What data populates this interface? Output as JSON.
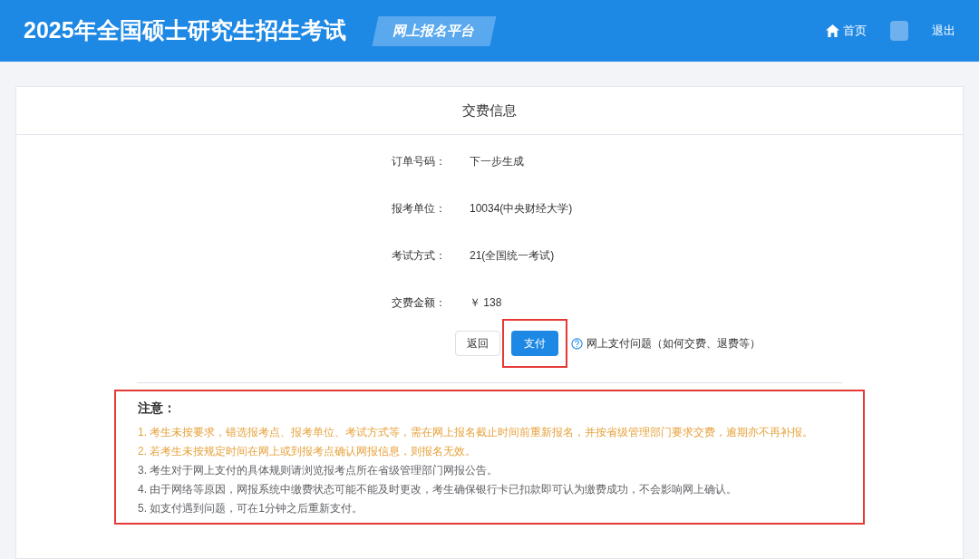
{
  "header": {
    "title": "2025年全国硕士研究生招生考试",
    "badge": "网上报名平台",
    "nav": [
      {
        "kind": "home",
        "label": "首页"
      },
      {
        "kind": "avatar"
      },
      {
        "kind": "plain",
        "label": "退出"
      }
    ]
  },
  "card": {
    "title": "交费信息",
    "fields": [
      {
        "label": "订单号码：",
        "value": "下一步生成"
      },
      {
        "label": "报考单位：",
        "value": "10034(中央财经大学)"
      },
      {
        "label": "考试方式：",
        "value": "21(全国统一考试)"
      },
      {
        "label": "交费金额：",
        "value": "￥ 138"
      }
    ],
    "buttons": [
      {
        "kind": "default",
        "label": "返回",
        "highlighted": false
      },
      {
        "kind": "primary",
        "label": "支付",
        "highlighted": true
      }
    ],
    "help_link": "网上支付问题（如何交费、退费等）",
    "notice": {
      "title": "注意：",
      "highlighted": true,
      "items": [
        {
          "text": "1. 考生未按要求，错选报考点、报考单位、考试方式等，需在网上报名截止时间前重新报名，并按省级管理部门要求交费，逾期亦不再补报。",
          "color": "#e6a23c"
        },
        {
          "text": "2. 若考生未按规定时间在网上或到报考点确认网报信息，则报名无效。",
          "color": "#e6a23c"
        },
        {
          "text": "3. 考生对于网上支付的具体规则请浏览报考点所在省级管理部门网报公告。",
          "color": "#606266"
        },
        {
          "text": "4. 由于网络等原因，网报系统中缴费状态可能不能及时更改，考生确保银行卡已扣款即可认为缴费成功，不会影响网上确认。",
          "color": "#606266"
        },
        {
          "text": "5. 如支付遇到问题，可在1分钟之后重新支付。",
          "color": "#606266"
        }
      ]
    }
  }
}
